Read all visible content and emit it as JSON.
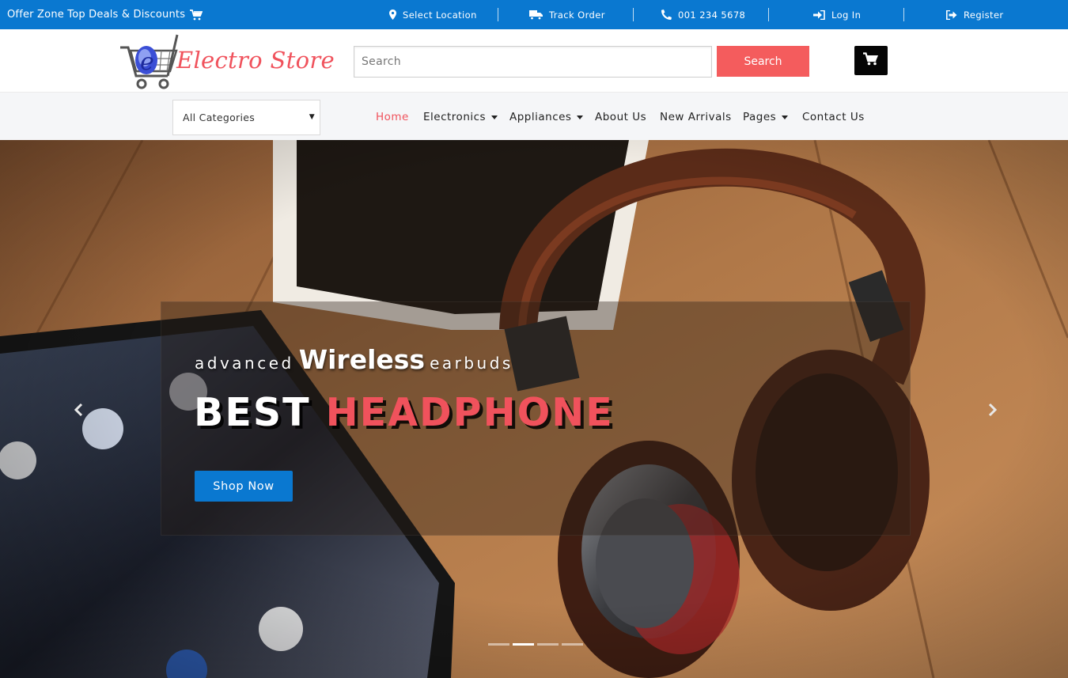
{
  "topbar": {
    "offer_text": "Offer Zone Top Deals & Discounts",
    "links": [
      {
        "label": "Select Location",
        "icon": "map-marker-icon"
      },
      {
        "label": "Track Order",
        "icon": "truck-icon"
      },
      {
        "label": "001 234 5678",
        "icon": "phone-icon"
      },
      {
        "label": "Log In",
        "icon": "sign-in-icon"
      },
      {
        "label": "Register",
        "icon": "sign-out-icon"
      }
    ]
  },
  "header": {
    "logo_text": "Electro Store",
    "search_placeholder": "Search",
    "search_button": "Search"
  },
  "nav": {
    "category_select": "All Categories",
    "items": [
      {
        "label": "Home",
        "active": true
      },
      {
        "label": "Electronics",
        "dropdown": true
      },
      {
        "label": "Appliances",
        "dropdown": true
      },
      {
        "label": "About Us"
      },
      {
        "label": "New Arrivals"
      },
      {
        "label": "Pages",
        "dropdown": true
      },
      {
        "label": "Contact Us"
      }
    ]
  },
  "hero": {
    "sub_left": "advanced",
    "sub_big": "Wireless",
    "sub_right": "earbuds",
    "headline_main": "BEST",
    "headline_accent": "HEADPHONE",
    "cta": "Shop Now",
    "slide_count": 4,
    "active_slide": 2
  },
  "colors": {
    "topbar": "#0a78d0",
    "accent": "#f0525c",
    "search_button": "#f45c5d",
    "primary_button": "#0a78d0"
  }
}
